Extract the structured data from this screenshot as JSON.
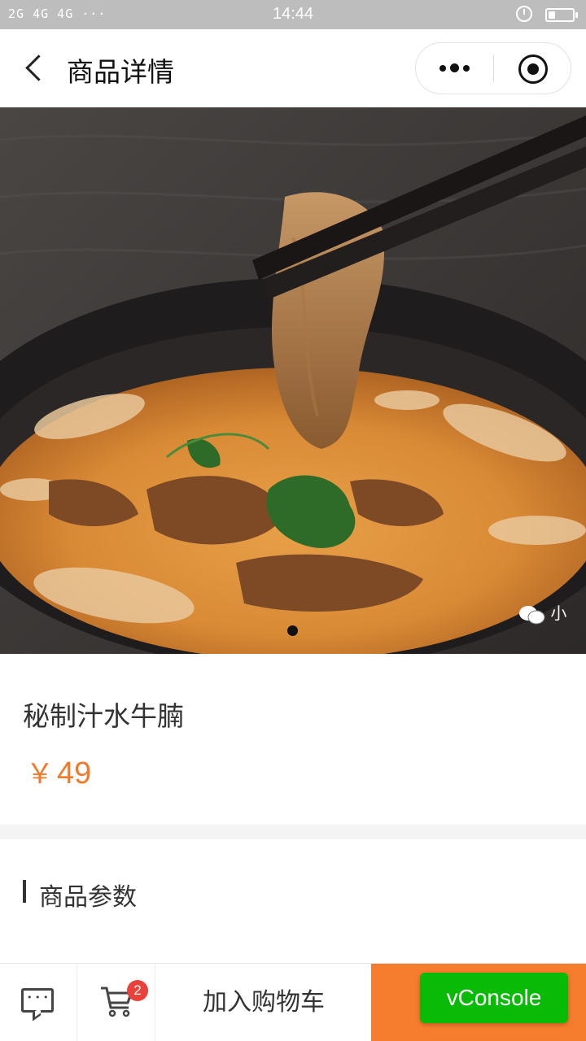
{
  "status_bar": {
    "signal": "2G 4G 4G ···",
    "time": "14:44",
    "battery_level": 0.3
  },
  "nav": {
    "title": "商品详情",
    "back_icon": "chevron-left-icon",
    "more_icon": "more-dots-icon",
    "close_icon": "target-close-icon"
  },
  "gallery": {
    "watermark": "小",
    "dots_total": 1,
    "active_dot": 1
  },
  "product": {
    "name": "秘制汁水牛腩",
    "currency": "￥",
    "price": "49",
    "price_color": "#f07a2a"
  },
  "params": {
    "label": "商品参数"
  },
  "bottom_bar": {
    "chat_icon": "chat-icon",
    "cart_icon": "cart-icon",
    "cart_count": "2",
    "add_to_cart": "加入购物车",
    "buy_color": "#f77d2e"
  },
  "vconsole": {
    "label": "vConsole",
    "color": "#09bb07"
  }
}
